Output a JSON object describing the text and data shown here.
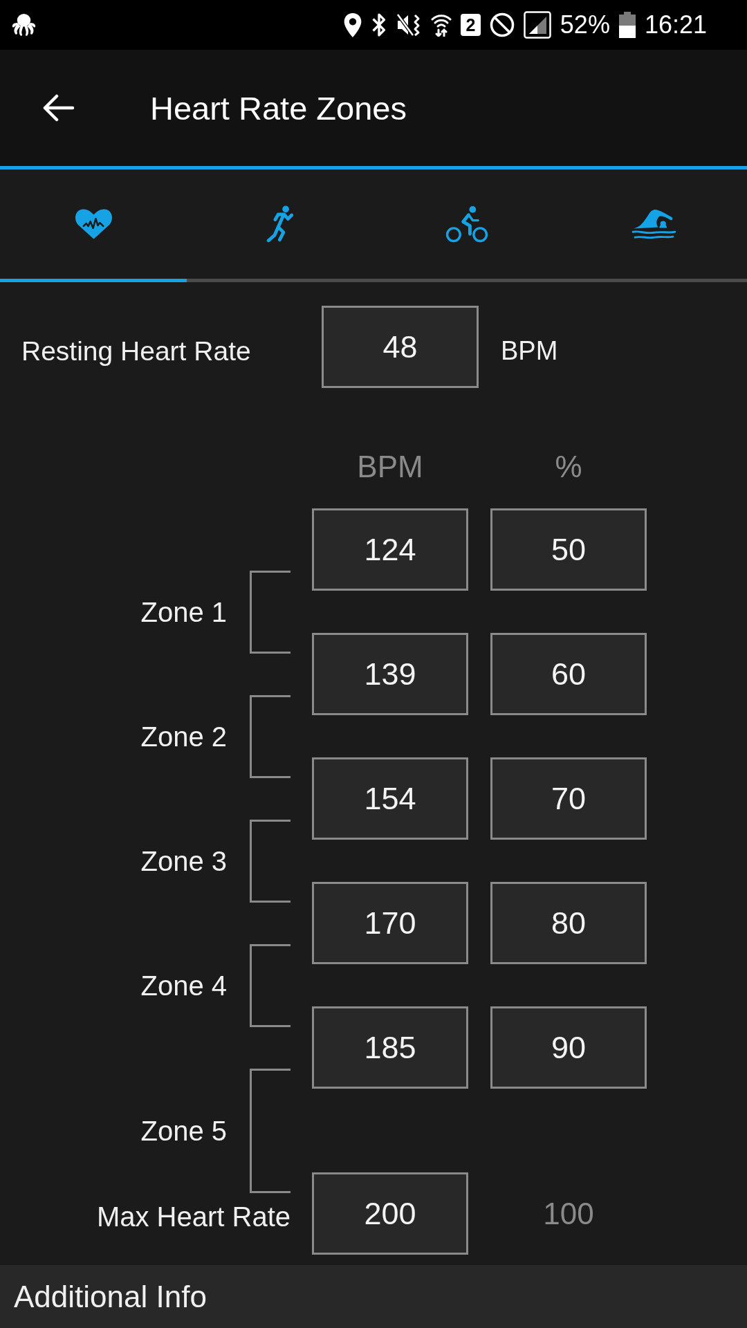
{
  "status_bar": {
    "sim_badge": "2",
    "battery": "52%",
    "time": "16:21"
  },
  "app_bar": {
    "title": "Heart Rate Zones"
  },
  "tabs": [
    {
      "kind": "heart",
      "selected": true
    },
    {
      "kind": "running",
      "selected": false
    },
    {
      "kind": "cycling",
      "selected": false
    },
    {
      "kind": "swimming",
      "selected": false
    }
  ],
  "resting": {
    "label": "Resting Heart Rate",
    "value": "48",
    "unit": "BPM"
  },
  "zones_table": {
    "columns": [
      "BPM",
      "%"
    ],
    "boundaries": [
      {
        "bpm": "124",
        "percent": "50"
      },
      {
        "bpm": "139",
        "percent": "60"
      },
      {
        "bpm": "154",
        "percent": "70"
      },
      {
        "bpm": "170",
        "percent": "80"
      },
      {
        "bpm": "185",
        "percent": "90"
      }
    ],
    "zones": [
      "Zone 1",
      "Zone 2",
      "Zone 3",
      "Zone 4",
      "Zone 5"
    ],
    "max": {
      "label": "Max Heart Rate",
      "bpm": "200",
      "percent": "100"
    }
  },
  "footer": {
    "label": "Additional Info"
  }
}
